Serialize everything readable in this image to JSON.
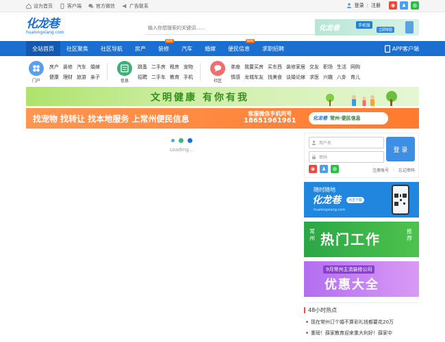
{
  "topbar": {
    "links": [
      {
        "label": "设为首页",
        "icon": "home-icon"
      },
      {
        "label": "客户端",
        "icon": "phone-icon"
      },
      {
        "label": "官方微信",
        "icon": "wechat-icon"
      },
      {
        "label": "广告联系",
        "icon": "megaphone-icon"
      }
    ],
    "login": "登录",
    "divider": "|",
    "register": "注册"
  },
  "header": {
    "logo_text": "化龙巷",
    "logo_url": "hualongxiang.com",
    "search_placeholder": "输入你想搜索的关键词......",
    "ad": {
      "brand": "化龙巷",
      "tag": "手机版",
      "cta": "立即体验"
    }
  },
  "nav": {
    "items": [
      {
        "label": "全站首页",
        "active": true,
        "new": false
      },
      {
        "label": "社区聚焦",
        "active": false,
        "new": false
      },
      {
        "label": "社区导航",
        "active": false,
        "new": false
      },
      {
        "label": "房产",
        "active": false,
        "new": false
      },
      {
        "label": "装修",
        "active": false,
        "new": true
      },
      {
        "label": "汽车",
        "active": false,
        "new": false
      },
      {
        "label": "婚嫁",
        "active": false,
        "new": false
      },
      {
        "label": "便民信息",
        "active": false,
        "new": true
      },
      {
        "label": "求职招聘",
        "active": false,
        "new": false
      }
    ],
    "new_tag": "NEW",
    "app_label": "APP客户端"
  },
  "categories": [
    {
      "head": "门户",
      "color": "#5aa0e8",
      "icon": "portal-icon",
      "cols": 4,
      "links": [
        "房产",
        "装修",
        "汽车",
        "婚嫁",
        "健康",
        "理财",
        "旅游",
        "亲子"
      ]
    },
    {
      "head": "信息",
      "color": "#3fb07a",
      "icon": "info-icon",
      "cols": 5,
      "links": [
        "跳蚤",
        "二手房",
        "租房",
        "宠物",
        "招聘",
        "二手车",
        "教育",
        "手机"
      ]
    },
    {
      "head": "社区",
      "color": "#f26d6d",
      "icon": "community-icon",
      "cols": 8,
      "links": [
        "茶座",
        "我要买房",
        "买东西",
        "装修家居",
        "交友",
        "职场",
        "生活",
        "网购",
        "情感",
        "龙城车友",
        "找美食",
        "谈婚论嫁",
        "求医",
        "兴趣",
        "八卦",
        "育儿"
      ]
    }
  ],
  "banners": {
    "banner1_text": "文明健康  有你有我",
    "banner2_text": "找宠物  找转让  找本地服务  上常州便民信息",
    "banner2_wx": [
      "客服微信手机同号",
      "18651961961"
    ],
    "banner2_brand": "化龙巷",
    "banner2_sub": "常州·便民信息"
  },
  "loading": {
    "text": "Loading..."
  },
  "login": {
    "username_placeholder": "用户名",
    "password_placeholder": "密码",
    "button": "登 录",
    "register_link": "注册账号",
    "forgot_link": "忘记密码"
  },
  "side_ads": {
    "ad1": {
      "line1": "随时随地",
      "line2": "化龙巷",
      "line3": "hualongxiang.com",
      "cta": "点击下载"
    },
    "ad2": {
      "left": "常州",
      "main": "热门工作",
      "right": "推荐"
    },
    "ad3": {
      "line1": "9月常州主流装修公司",
      "line2": "优惠大全"
    }
  },
  "hot": {
    "title": "48小时热点",
    "items": [
      "现在常州订个婚不算彩礼钱都要花20万",
      "重磅！薛家教育迎来重大利好！薛家中"
    ]
  },
  "colors": {
    "primary": "#1a6fd0",
    "nav_active": "#1558b0",
    "new_tag": "#ff6a00",
    "login_button": "#3d8fe6",
    "loading_dots": [
      "#5aa0e8",
      "#2fbf71",
      "#1a6fd0"
    ]
  }
}
